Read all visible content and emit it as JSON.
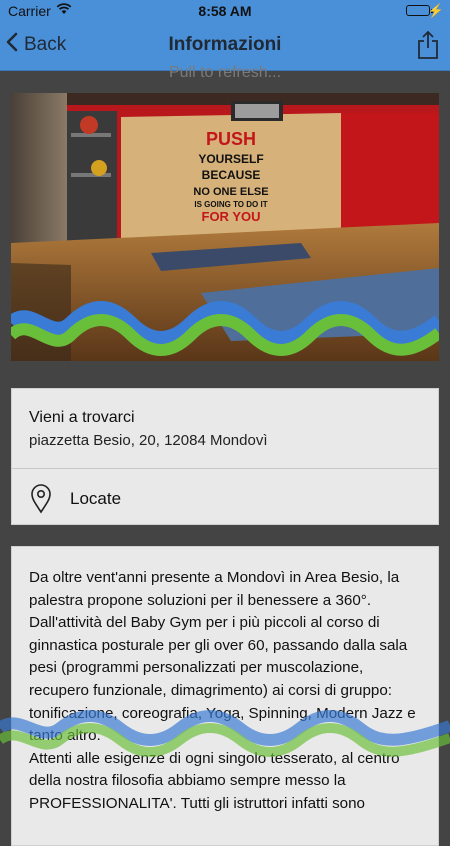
{
  "status_bar": {
    "carrier": "Carrier",
    "time": "8:58 AM",
    "battery_level": 1.0
  },
  "nav_bar": {
    "back_label": "Back",
    "title": "Informazioni",
    "share_icon": "share-icon"
  },
  "refresh_hint": "Pull to refresh...",
  "hero_image": {
    "wall_text": [
      "PUSH",
      "YOURSELF",
      "BECAUSE",
      "NO ONE ELSE",
      "IS GOING TO DO IT",
      "FOR YOU"
    ]
  },
  "location_card": {
    "heading": "Vieni a trovarci",
    "address": "piazzetta Besio, 20, 12084 Mondovì",
    "locate_label": "Locate",
    "locate_icon": "map-pin-icon"
  },
  "description": {
    "paragraphs": [
      "Da oltre vent'anni presente a Mondovì in Area Besio, la palestra propone soluzioni per il benessere a 360°.",
      "Dall'attività del Baby Gym per i più piccoli al corso di ginnastica posturale per gli over 60, passando dalla sala pesi (programmi personalizzati per muscolazione, recupero funzionale, dimagrimento) ai corsi di gruppo: tonificazione, coreografia, Yoga, Spinning, Modern Jazz e tanto altro.",
      "Attenti alle esigenze di ogni singolo tesserato, al centro della nostra filosofia abbiamo sempre messo la PROFESSIONALITA'. Tutti gli istruttori infatti sono"
    ]
  },
  "colors": {
    "nav_blue": "#4a90d9",
    "background": "#444444",
    "card": "#e9e9e9",
    "wall_red": "#c4161c",
    "ribbon_blue": "#3a7bd5",
    "ribbon_green": "#6abf3a"
  }
}
